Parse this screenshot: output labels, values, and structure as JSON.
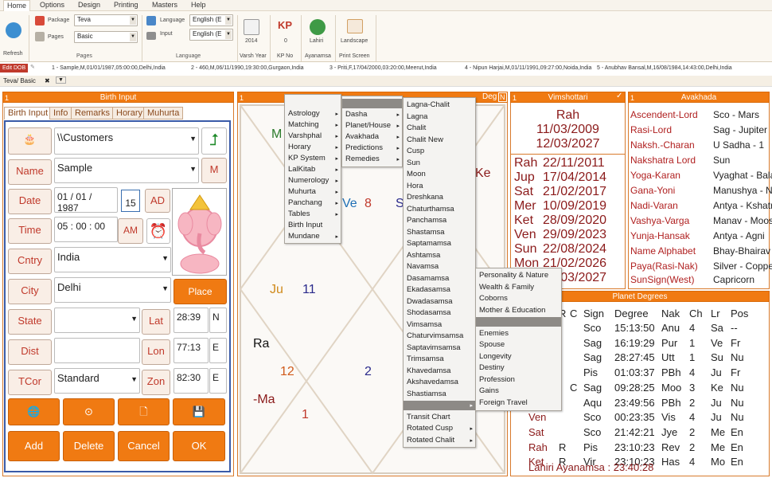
{
  "menubar": {
    "items": [
      "Home",
      "Options",
      "Design",
      "Printing",
      "Masters",
      "Help"
    ]
  },
  "ribbon": {
    "refresh": "Refresh",
    "package_label": "Package",
    "package_value": "Teva",
    "pages_label": "Pages",
    "pages_value": "Basic",
    "pages_group": "Pages",
    "language_label": "Language",
    "language_value": "English (E",
    "input_label": "Input",
    "input_value": "English (E",
    "language_group": "Language",
    "varsh_num": "2014",
    "varsh_label": "Varsh Year",
    "kp_num": "0",
    "kp_label": "KP No",
    "lahiri_small": "Lahiri",
    "ayanamsa_label": "Ayanamsa",
    "landscape_small": "Landscape",
    "print_label": "Print Screen"
  },
  "records": {
    "edit_dob": "Edit DOB",
    "items": [
      "1 - Sample,M,01/01/1987,05:00:00,Delhi,India",
      "2 - 460,M,06/11/1990,19:30:00,Gurgaon,India",
      "3 - Priti,F,17/04/2000,03:20:00,Meerut,India",
      "4 - Nipun Harjai,M,01/11/1991,09:27:00,Noida,India",
      "5 - Anubhav Bansal,M,16/08/1984,14:43:00,Delhi,India"
    ]
  },
  "doc_tab": "Teva/ Basic",
  "birth": {
    "header": "Birth Input",
    "num": "1",
    "tabs": [
      "Birth Input",
      "Info",
      "Remarks",
      "Horary",
      "Muhurta"
    ],
    "customer": "\\\\Customers",
    "name_label": "Name",
    "name_value": "Sample",
    "m_btn": "M",
    "date_label": "Date",
    "date_value": "01 / 01 / 1987",
    "cal_num": "15",
    "ad_btn": "AD",
    "time_label": "Time",
    "time_value": "05 :  00  :  00",
    "am_btn": "AM",
    "cntry_label": "Cntry",
    "cntry_value": "India",
    "city_label": "City",
    "city_value": "Delhi",
    "place_finder": "Place Finder",
    "state_label": "State",
    "lat_btn": "Lat",
    "lat_value": "28:39",
    "lat_dir": "N",
    "dist_label": "Dist",
    "lon_btn": "Lon",
    "lon_value": "77:13",
    "lon_dir": "E",
    "tcor_label": "TCor",
    "tcor_value": "Standard",
    "zon_btn": "Zon",
    "zon_value": "82:30",
    "zon_dir": "E",
    "add": "Add",
    "delete": "Delete",
    "cancel": "Cancel",
    "ok": "OK"
  },
  "chart": {
    "num": "1",
    "header": "Deg",
    "hdr_n": "N",
    "labels": {
      "m": "M",
      "ke": "Ke",
      "ve": "Ve",
      "ve_num": "8",
      "s": "S",
      "ju": "Ju",
      "n11": "11",
      "ra": "Ra",
      "n12": "12",
      "n2": "2",
      "ma": "-Ma",
      "n1": "1"
    }
  },
  "vimshottari": {
    "num": "1",
    "header": "Vimshottari",
    "check": "✓",
    "current": "Rah",
    "start": "11/03/2009",
    "end": "12/03/2027",
    "rows": [
      [
        "Rah",
        "22/11/2011"
      ],
      [
        "Jup",
        "17/04/2014"
      ],
      [
        "Sat",
        "21/02/2017"
      ],
      [
        "Mer",
        "10/09/2019"
      ],
      [
        "Ket",
        "28/09/2020"
      ],
      [
        "Ven",
        "29/09/2023"
      ],
      [
        "Sun",
        "22/08/2024"
      ],
      [
        "Mon",
        "21/02/2026"
      ],
      [
        "",
        "12/03/2027"
      ]
    ]
  },
  "avakhada": {
    "num": "1",
    "header": "Avakhada",
    "rows": [
      [
        "Ascendent-Lord",
        "Sco - Mars"
      ],
      [
        "Rasi-Lord",
        "Sag - Jupiter"
      ],
      [
        "Naksh.-Charan",
        "U Sadha - 1"
      ],
      [
        "Nakshatra Lord",
        "Sun"
      ],
      [
        "Yoga-Karan",
        "Vyaghat - Balava"
      ],
      [
        "Gana-Yoni",
        "Manushya - Nakul"
      ],
      [
        "Nadi-Varan",
        "Antya - Kshatriya"
      ],
      [
        "Vashya-Varga",
        "Manav - Mooshak"
      ],
      [
        "Yunja-Hansak",
        "Antya - Agni"
      ],
      [
        "Name Alphabet",
        "Bhay-Bhairav"
      ],
      [
        "Paya(Rasi-Nak)",
        "Silver - Copper"
      ],
      [
        "SunSign(West)",
        "Capricorn"
      ]
    ]
  },
  "degrees": {
    "header": "Planet Degrees",
    "cols": [
      "R",
      "C",
      "Sign",
      "Degree",
      "Nak",
      "Ch",
      "Lr",
      "Pos"
    ],
    "rows": [
      [
        "",
        "",
        "",
        "Sco",
        "15:13:50",
        "Anu",
        "4",
        "Sa",
        "--"
      ],
      [
        "",
        "",
        "",
        "Sag",
        "16:19:29",
        "Pur",
        "1",
        "Ve",
        "Fr"
      ],
      [
        "",
        "",
        "",
        "Sag",
        "28:27:45",
        "Utt",
        "1",
        "Su",
        "Nu"
      ],
      [
        "",
        "",
        "",
        "Pis",
        "01:03:37",
        "PBh",
        "4",
        "Ju",
        "Fr"
      ],
      [
        "",
        "",
        "C",
        "Sag",
        "09:28:25",
        "Moo",
        "3",
        "Ke",
        "Nu"
      ],
      [
        "",
        "",
        "",
        "Aqu",
        "23:49:56",
        "PBh",
        "2",
        "Ju",
        "Nu"
      ],
      [
        "Ven",
        "",
        "",
        "Sco",
        "00:23:35",
        "Vis",
        "4",
        "Ju",
        "Nu"
      ],
      [
        "Sat",
        "",
        "",
        "Sco",
        "21:42:21",
        "Jye",
        "2",
        "Me",
        "En"
      ],
      [
        "Rah",
        "R",
        "",
        "Pis",
        "23:10:23",
        "Rev",
        "2",
        "Me",
        "En"
      ],
      [
        "Ket",
        "R",
        "",
        "Vir",
        "23:10:23",
        "Has",
        "4",
        "Mo",
        "En"
      ]
    ],
    "ayanamsa": "Lahiri Ayanamsa : 23:40:28"
  },
  "menus": {
    "main": [
      "Astrology",
      "Matching",
      "Varshphal",
      "Horary",
      "KP System",
      "LalKitab",
      "Numerology",
      "Muhurta",
      "Panchang",
      "Tables",
      "Birth Input",
      "Mundane"
    ],
    "sub": [
      "Dasha",
      "Planet/House",
      "Avakhada",
      "Predictions",
      "Remedies"
    ],
    "charts": [
      "Lagna-Chalit",
      "Lagna",
      "Chalit",
      "Chalit New",
      "Cusp",
      "Sun",
      "Moon",
      "Hora",
      "Dreshkana",
      "Chaturthamsa",
      "Panchamsa",
      "Shastamsa",
      "Saptamamsa",
      "Ashtamsa",
      "Navamsa",
      "Dasamamsa",
      "Ekadasamsa",
      "Dwadasamsa",
      "Shodasamsa",
      "Vimsamsa",
      "Chaturvimsamsa",
      "Saptavimsamsa",
      "Trimsamsa",
      "Khavedamsa",
      "Akshavedamsa",
      "Shastiamsa",
      "",
      "Transit Chart",
      "Rotated Cusp",
      "Rotated Chalit"
    ],
    "bhava": [
      "Personality & Nature",
      "Wealth & Family",
      "Coborns",
      "Mother & Education",
      "",
      "Enemies",
      "Spouse",
      "Longevity",
      "Destiny",
      "Profession",
      "Gains",
      "Foreign Travel"
    ]
  },
  "colors": {
    "accent": "#f07a12",
    "dark_red": "#8b1a1a",
    "highlight": "#8d8a86"
  }
}
